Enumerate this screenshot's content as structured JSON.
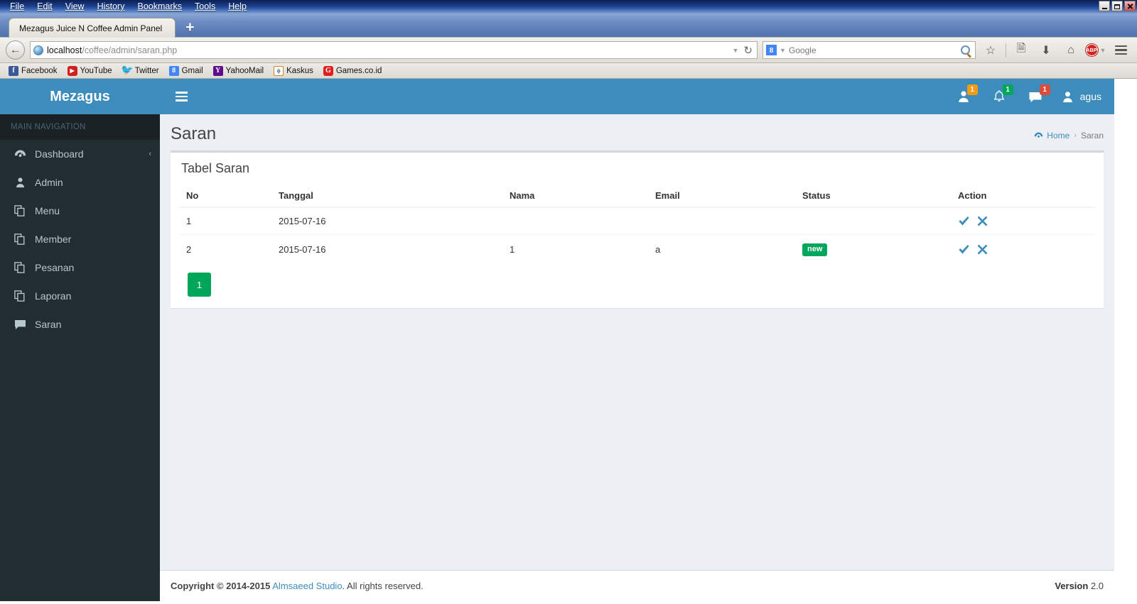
{
  "browser": {
    "menus": [
      "File",
      "Edit",
      "View",
      "History",
      "Bookmarks",
      "Tools",
      "Help"
    ],
    "window_controls": [
      "minimize",
      "maximize",
      "close"
    ],
    "tab_title": "Mezagus Juice N Coffee Admin Panel",
    "new_tab_label": "+",
    "url_host": "localhost",
    "url_path": "/coffee/admin/saran.php",
    "search_engine": "Google",
    "search_placeholder": "Google",
    "toolbar_icons": [
      "bookmark-star-icon",
      "reader-list-icon",
      "downloads-icon",
      "home-icon",
      "adblock-icon",
      "menu-icon"
    ],
    "adblock_label": "ABP",
    "bookmarks": [
      {
        "label": "Facebook",
        "icon": "facebook-icon",
        "glyph": "f"
      },
      {
        "label": "YouTube",
        "icon": "youtube-icon",
        "glyph": "▶"
      },
      {
        "label": "Twitter",
        "icon": "twitter-icon",
        "glyph": "ᵗ"
      },
      {
        "label": "Gmail",
        "icon": "gmail-icon",
        "glyph": "8"
      },
      {
        "label": "YahooMail",
        "icon": "yahoo-icon",
        "glyph": "Y"
      },
      {
        "label": "Kaskus",
        "icon": "kaskus-icon",
        "glyph": "ф"
      },
      {
        "label": "Games.co.id",
        "icon": "games-icon",
        "glyph": "G"
      }
    ]
  },
  "app": {
    "logo": "Mezagus",
    "sidebar": {
      "header": "MAIN NAVIGATION",
      "items": [
        {
          "label": "Dashboard",
          "icon": "dashboard-icon",
          "arrow": "‹"
        },
        {
          "label": "Admin",
          "icon": "user-icon",
          "arrow": ""
        },
        {
          "label": "Menu",
          "icon": "files-icon",
          "arrow": ""
        },
        {
          "label": "Member",
          "icon": "files-icon",
          "arrow": ""
        },
        {
          "label": "Pesanan",
          "icon": "files-icon",
          "arrow": ""
        },
        {
          "label": "Laporan",
          "icon": "files-icon",
          "arrow": ""
        },
        {
          "label": "Saran",
          "icon": "comment-icon",
          "arrow": ""
        }
      ]
    },
    "topnav": {
      "toggle_icon": "hamburger-icon",
      "notifications": [
        {
          "icon": "users-icon",
          "badge": "1",
          "color": "#f39c12"
        },
        {
          "icon": "bell-icon",
          "badge": "1",
          "color": "#00a65a"
        },
        {
          "icon": "envelope-icon",
          "badge": "1",
          "color": "#dd4b39"
        }
      ],
      "user_name": "agus",
      "user_icon": "user-avatar-icon"
    },
    "page": {
      "title": "Saran",
      "breadcrumb": {
        "home": "Home",
        "home_icon": "dashboard-icon",
        "separator": "›",
        "current": "Saran"
      }
    },
    "box": {
      "title": "Tabel Saran",
      "table": {
        "columns": [
          "No",
          "Tanggal",
          "Nama",
          "Email",
          "Status",
          "Action"
        ],
        "rows": [
          {
            "no": "1",
            "tanggal": "2015-07-16",
            "nama": "",
            "email": "",
            "status": "",
            "actions": [
              "check-icon",
              "close-icon"
            ]
          },
          {
            "no": "2",
            "tanggal": "2015-07-16",
            "nama": "1",
            "email": "a",
            "status": "new",
            "actions": [
              "check-icon",
              "close-icon"
            ]
          }
        ]
      },
      "pagination": [
        "1"
      ]
    },
    "footer": {
      "copyright_prefix": "Copyright © 2014-2015",
      "studio": "Almsaeed Studio",
      "copyright_suffix": ". All rights reserved.",
      "version_label": "Version",
      "version_number": "2.0"
    }
  },
  "colors": {
    "brand": "#3c8dbc",
    "sidebar": "#222d32",
    "success": "#00a65a",
    "warning": "#f39c12",
    "danger": "#dd4b39",
    "body": "#ecf0f5"
  }
}
